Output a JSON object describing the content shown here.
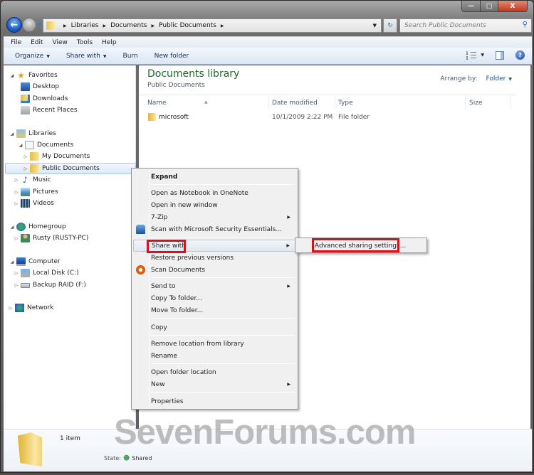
{
  "window": {
    "caption_buttons": {
      "minimize": "—",
      "maximize": "□",
      "close": "X"
    }
  },
  "navbar": {
    "back_icon": "back-arrow",
    "forward_icon": "forward-arrow",
    "breadcrumb": [
      "Libraries",
      "Documents",
      "Public Documents"
    ],
    "refresh_icon": "↻",
    "search_placeholder": "Search Public Documents",
    "search_icon": "⚲"
  },
  "menubar": [
    "File",
    "Edit",
    "View",
    "Tools",
    "Help"
  ],
  "toolbar": {
    "organize": "Organize",
    "share_with": "Share with",
    "burn": "Burn",
    "new_folder": "New folder",
    "help": "?"
  },
  "nav_pane": {
    "favorites": {
      "label": "Favorites",
      "items": [
        "Desktop",
        "Downloads",
        "Recent Places"
      ]
    },
    "libraries": {
      "label": "Libraries",
      "documents": "Documents",
      "doc_children": [
        "My Documents",
        "Public Documents"
      ],
      "others": [
        "Music",
        "Pictures",
        "Videos"
      ]
    },
    "homegroup": {
      "label": "Homegroup",
      "items": [
        "Rusty (RUSTY-PC)"
      ]
    },
    "computer": {
      "label": "Computer",
      "items": [
        "Local Disk (C:)",
        "Backup RAID (F:)"
      ]
    },
    "network": {
      "label": "Network"
    }
  },
  "content": {
    "title": "Documents library",
    "subtitle": "Public Documents",
    "arrange_label": "Arrange by:",
    "arrange_value": "Folder",
    "columns": [
      "Name",
      "Date modified",
      "Type",
      "Size"
    ],
    "rows": [
      {
        "name": "microsoft",
        "date": "10/1/2009 2:22 PM",
        "type": "File folder",
        "size": ""
      }
    ]
  },
  "context_menu": {
    "items": [
      {
        "label": "Expand",
        "bold": true
      },
      {
        "label": "Open as Notebook in OneNote"
      },
      {
        "label": "Open in new window"
      },
      {
        "label": "7-Zip",
        "submenu": true
      },
      {
        "label": "Scan with Microsoft Security Essentials..."
      },
      {
        "label": "Share with",
        "submenu": true,
        "highlighted": true
      },
      {
        "label": "Restore previous versions"
      },
      {
        "label": "Scan Documents"
      },
      {
        "label": "Send to",
        "submenu": true
      },
      {
        "label": "Copy To folder..."
      },
      {
        "label": "Move To folder..."
      },
      {
        "label": "Copy"
      },
      {
        "label": "Remove location from library"
      },
      {
        "label": "Rename"
      },
      {
        "label": "Open folder location"
      },
      {
        "label": "New",
        "submenu": true
      },
      {
        "label": "Properties"
      }
    ],
    "submenu_item": "Advanced sharing settings...",
    "highlight_color": "#d8101e"
  },
  "details": {
    "count": "1 item",
    "state_label": "State:",
    "state_value": "Shared"
  },
  "watermark": "SevenForums.com"
}
